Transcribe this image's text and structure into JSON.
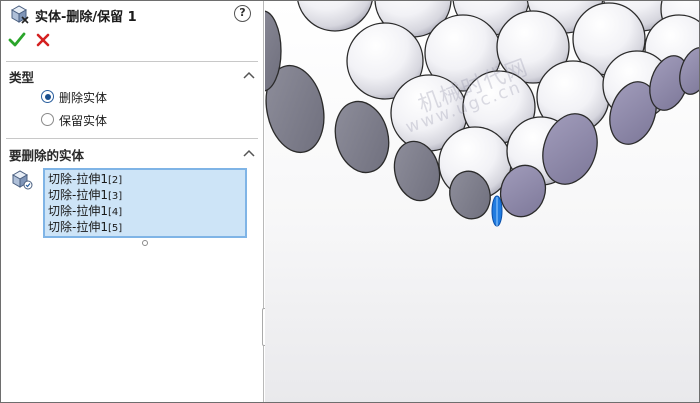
{
  "title": "实体-删除/保留 1",
  "help": "?",
  "type_section": {
    "title": "类型",
    "options": [
      {
        "label": "删除实体",
        "checked": true
      },
      {
        "label": "保留实体",
        "checked": false
      }
    ]
  },
  "bodies_section": {
    "title": "要删除的实体",
    "items": [
      {
        "name": "切除-拉伸1",
        "suffix": "[2]"
      },
      {
        "name": "切除-拉伸1",
        "suffix": "[3]"
      },
      {
        "name": "切除-拉伸1",
        "suffix": "[4]"
      },
      {
        "name": "切除-拉伸1",
        "suffix": "[5]"
      }
    ]
  },
  "watermark": {
    "line1": "机械时代网",
    "line2": "www.ugc.cn"
  },
  "icons": {
    "title": "part-body-delete-icon",
    "ok": "green-check-icon",
    "cancel": "red-x-icon",
    "bodies": "solid-bodies-icon",
    "collapse": "chevron-up-icon"
  },
  "colors": {
    "ok": "#2aa52a",
    "cancel": "#d42020",
    "selection_bg": "#cde4f7",
    "selection_border": "#7fb4e6",
    "sphere_face": "#8b86a8"
  }
}
